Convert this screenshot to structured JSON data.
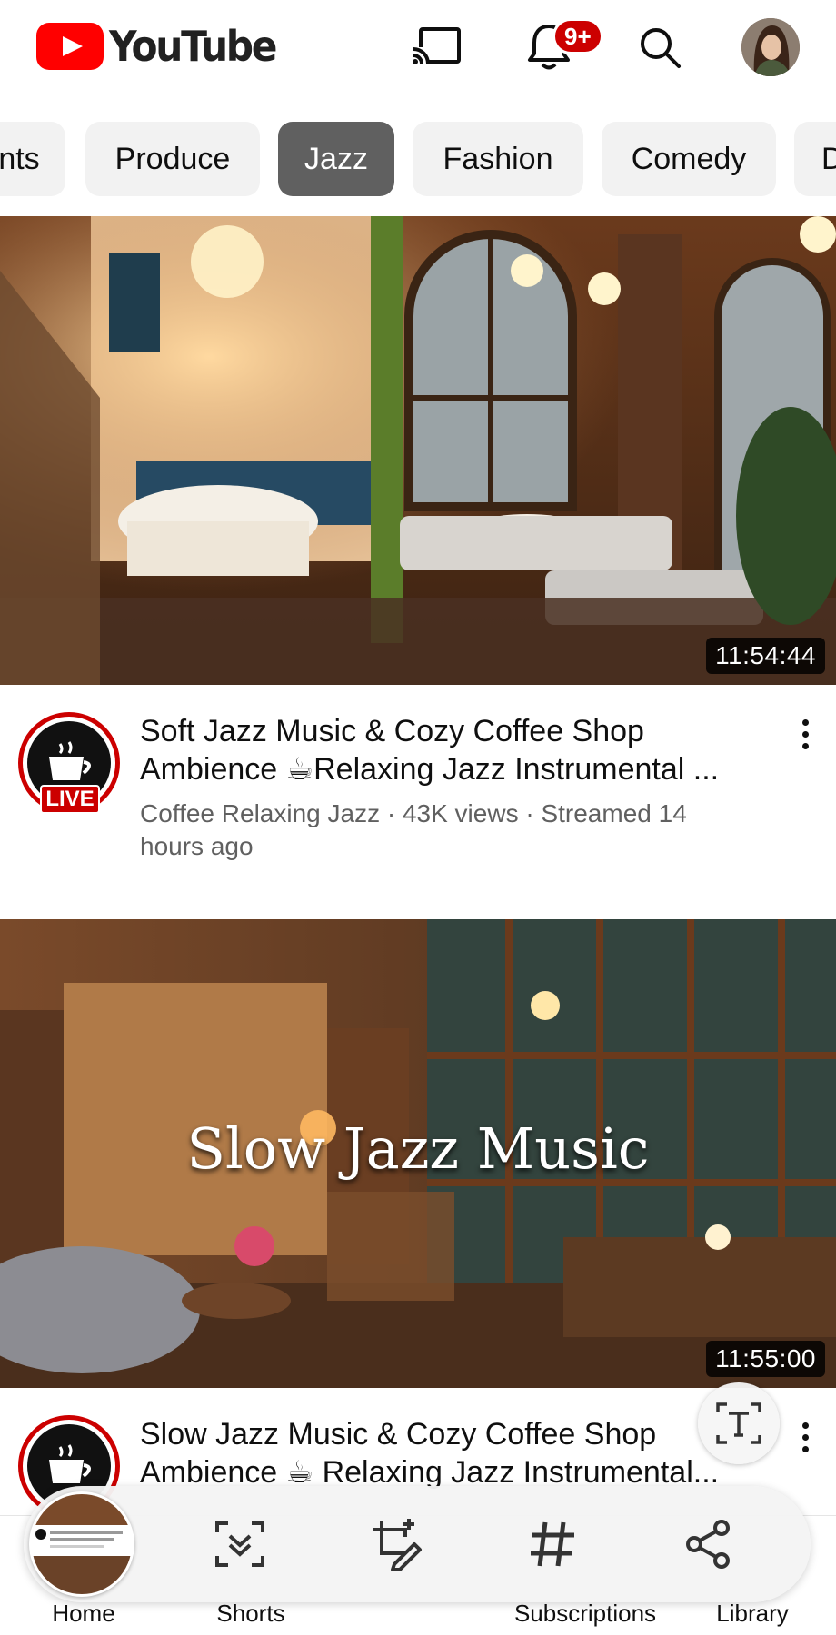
{
  "app": {
    "name": "YouTube"
  },
  "header": {
    "logo_text": "YouTube",
    "notifications_badge": "9+",
    "icons": [
      "cast-icon",
      "bell-icon",
      "search-icon",
      "avatar"
    ]
  },
  "chips": [
    {
      "label": "nts",
      "active": false
    },
    {
      "label": "Produce",
      "active": false
    },
    {
      "label": "Jazz",
      "active": true
    },
    {
      "label": "Fashion",
      "active": false
    },
    {
      "label": "Comedy",
      "active": false
    },
    {
      "label": "D",
      "active": false
    }
  ],
  "videos": [
    {
      "duration": "11:54:44",
      "title": "Soft Jazz Music & Cozy Coffee Shop Ambience ☕Relaxing Jazz Instrumental ...",
      "title_line1": "Soft Jazz Music & Cozy Coffee Shop",
      "title_line2": "Ambience ☕Relaxing Jazz Instrumental ...",
      "meta_line1": "Coffee Relaxing Jazz · 43K views · Streamed 14",
      "meta_line2": "hours ago",
      "live_label": "LIVE"
    },
    {
      "duration": "11:55:00",
      "thumbnail_text": "Slow Jazz Music",
      "title_line1": "Slow Jazz Music & Cozy Coffee Shop",
      "title_line2": "Ambience ☕ Relaxing Jazz Instrumental..."
    }
  ],
  "bottom_nav": {
    "items": [
      "Home",
      "Shorts",
      "",
      "Subscriptions",
      "Library"
    ]
  },
  "toolbar": {
    "buttons": [
      "scroll-capture-icon",
      "crop-edit-icon",
      "hashtag-icon",
      "share-icon"
    ],
    "extract_text_icon": "text-extract-icon"
  },
  "colors": {
    "brand_red": "#ff0000",
    "active_chip": "#606060",
    "chip_bg": "#f2f2f2",
    "meta_text": "#606060"
  }
}
